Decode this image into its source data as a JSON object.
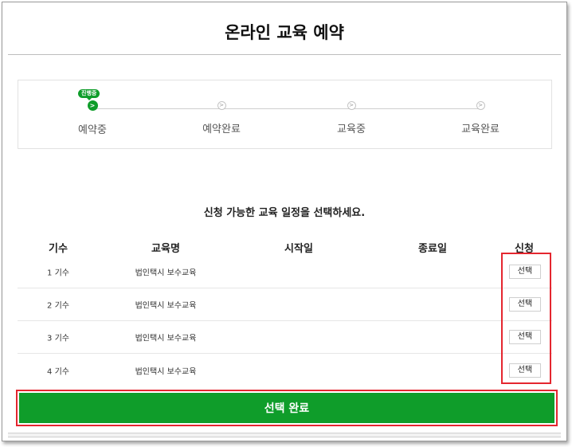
{
  "header": {
    "title": "온라인 교육 예약"
  },
  "steps": {
    "badge": "진행중",
    "items": [
      {
        "label": "예약중",
        "icon": ">",
        "active": true
      },
      {
        "label": "예약완료",
        "icon": ">",
        "active": false
      },
      {
        "label": "교육중",
        "icon": ">",
        "active": false
      },
      {
        "label": "교육완료",
        "icon": ">",
        "active": false
      }
    ]
  },
  "instruction": "신청 가능한 교육 일정을 선택하세요.",
  "table": {
    "headers": [
      "기수",
      "교육명",
      "시작일",
      "종료일",
      "신청"
    ],
    "rows": [
      {
        "session": "1 기수",
        "course": "법인택시 보수교육",
        "start": "",
        "end": "",
        "action": "선택"
      },
      {
        "session": "2 기수",
        "course": "법인택시 보수교육",
        "start": "",
        "end": "",
        "action": "선택"
      },
      {
        "session": "3 기수",
        "course": "법인택시 보수교육",
        "start": "",
        "end": "",
        "action": "선택"
      },
      {
        "session": "4 기수",
        "course": "법인택시 보수교육",
        "start": "",
        "end": "",
        "action": "선택"
      }
    ]
  },
  "footer": {
    "complete_label": "선택 완료"
  },
  "colors": {
    "accent": "#0f9d2a",
    "highlight": "#e4262f"
  }
}
